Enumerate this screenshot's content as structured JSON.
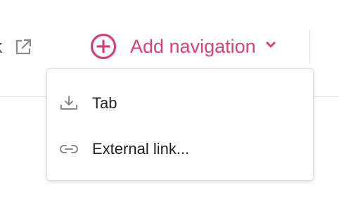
{
  "toolbar": {
    "partial_link_text": "k",
    "add_navigation_label": "Add navigation"
  },
  "menu": {
    "items": [
      {
        "label": "Tab",
        "icon": "tab-download-icon"
      },
      {
        "label": "External link...",
        "icon": "link-icon"
      }
    ]
  },
  "colors": {
    "accent": "#d93f78",
    "icon_gray": "#8a8a8a",
    "text": "#222222"
  }
}
